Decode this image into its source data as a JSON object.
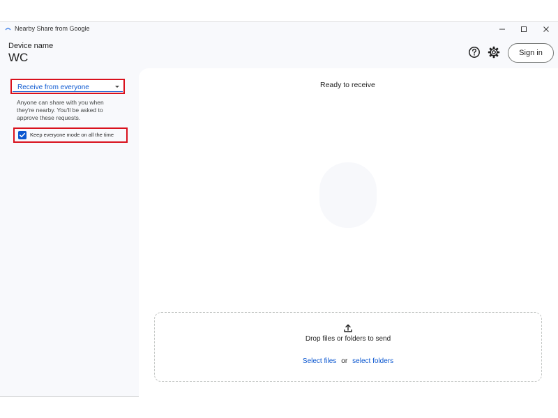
{
  "window": {
    "title": "Nearby Share from Google"
  },
  "header": {
    "device_label": "Device name",
    "device_name": "WC",
    "sign_in_label": "Sign in",
    "icons": [
      "help-icon",
      "gear-icon"
    ]
  },
  "sidebar": {
    "receive_mode": "Receive from everyone",
    "description": "Anyone can share with you when they're nearby. You'll be asked to approve these requests.",
    "keep_mode_label": "Keep everyone mode on all the time",
    "keep_mode_checked": true
  },
  "main": {
    "status": "Ready to receive",
    "drop_text": "Drop files or folders to send",
    "select_files": "Select files",
    "or_text": "or",
    "select_folders": "select folders"
  },
  "colors": {
    "accent": "#0b57d0",
    "highlight": "#d9111d",
    "background": "#f8f9fc"
  }
}
